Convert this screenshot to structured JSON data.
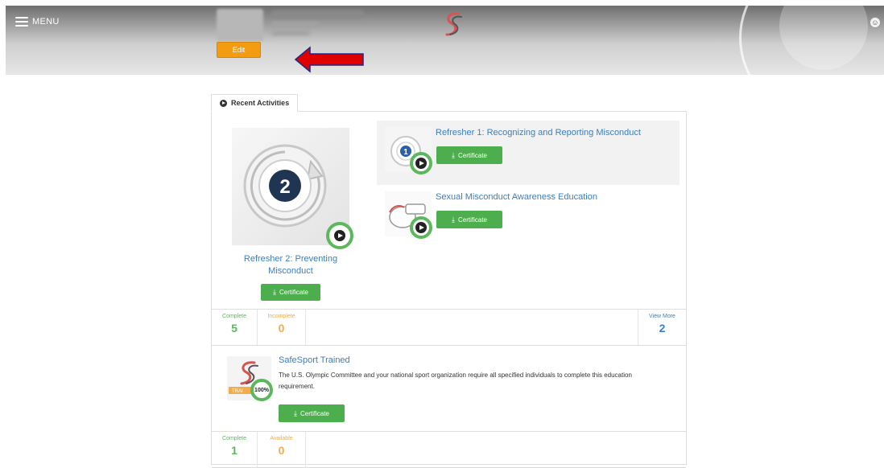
{
  "header": {
    "menu_label": "MENU",
    "edit_label": "Edit"
  },
  "tab": {
    "label": "Recent Activities"
  },
  "featured": {
    "title": "Refresher 2: Preventing Misconduct",
    "badge_number": "2",
    "certificate_label": "Certificate"
  },
  "activities": [
    {
      "title": "Refresher 1: Recognizing and Reporting Misconduct",
      "badge_number": "1",
      "certificate_label": "Certificate"
    },
    {
      "title": "Sexual Misconduct Awareness Education",
      "certificate_label": "Certificate"
    }
  ],
  "stats": {
    "complete_label": "Complete",
    "complete_value": "5",
    "incomplete_label": "Incomplete",
    "incomplete_value": "0",
    "view_more_label": "View More",
    "view_more_value": "2"
  },
  "trained": {
    "title": "SafeSport Trained",
    "description": "The U.S. Olympic Committee and your national sport organization require all specified individuals to complete this education requirement.",
    "progress": "100%",
    "certificate_label": "Certificate",
    "badge_text": "TRAI"
  },
  "stats2": {
    "complete_label": "Complete",
    "complete_value": "1",
    "available_label": "Available",
    "available_value": "0"
  },
  "colors": {
    "accent_green": "#5cb85c",
    "certificate_green": "#4cae4c",
    "edit_orange": "#f39c12",
    "link_blue": "#3a7fc1",
    "arrow_red": "#e00000"
  }
}
